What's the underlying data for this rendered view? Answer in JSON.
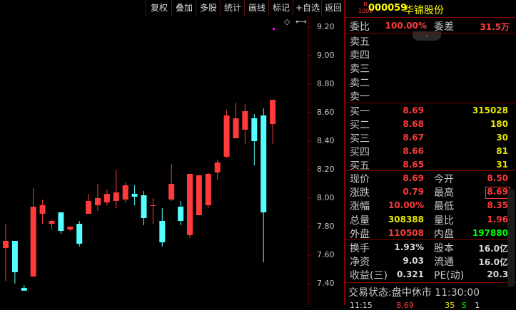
{
  "toolbar": {
    "items": [
      "复权",
      "叠加",
      "多股",
      "统计",
      "画线",
      "标记",
      "+自选",
      "返回"
    ]
  },
  "chart": {
    "y_labels": [
      "9.20",
      "9.00",
      "8.80",
      "8.60",
      "8.40",
      "8.20",
      "8.00",
      "7.80",
      "7.60",
      "7.40"
    ],
    "candles": [
      {
        "o": 7.65,
        "h": 7.82,
        "l": 7.42,
        "c": 7.7
      },
      {
        "o": 7.7,
        "h": 7.7,
        "l": 7.4,
        "c": 7.48
      },
      {
        "o": 7.37,
        "h": 7.39,
        "l": 7.35,
        "c": 7.35
      },
      {
        "o": 7.45,
        "h": 8.07,
        "l": 7.45,
        "c": 7.94
      },
      {
        "o": 7.89,
        "h": 7.99,
        "l": 7.82,
        "c": 7.95
      },
      {
        "o": 7.82,
        "h": 7.85,
        "l": 7.78,
        "c": 7.84
      },
      {
        "o": 7.9,
        "h": 7.9,
        "l": 7.75,
        "c": 7.77
      },
      {
        "o": 7.78,
        "h": 7.8,
        "l": 7.77,
        "c": 7.8
      },
      {
        "o": 7.82,
        "h": 7.84,
        "l": 7.66,
        "c": 7.68
      },
      {
        "o": 7.89,
        "h": 8.03,
        "l": 7.89,
        "c": 7.98
      },
      {
        "o": 7.95,
        "h": 8.1,
        "l": 7.91,
        "c": 8.0
      },
      {
        "o": 7.97,
        "h": 8.06,
        "l": 7.95,
        "c": 8.03
      },
      {
        "o": 7.98,
        "h": 8.2,
        "l": 7.93,
        "c": 8.04
      },
      {
        "o": 7.99,
        "h": 8.11,
        "l": 7.97,
        "c": 8.09
      },
      {
        "o": 8.03,
        "h": 8.09,
        "l": 7.95,
        "c": 8.01
      },
      {
        "o": 8.02,
        "h": 8.05,
        "l": 7.81,
        "c": 7.86
      },
      {
        "o": 7.95,
        "h": 8.0,
        "l": 7.82,
        "c": 7.95
      },
      {
        "o": 7.84,
        "h": 7.93,
        "l": 7.66,
        "c": 7.69
      },
      {
        "o": 7.99,
        "h": 8.24,
        "l": 7.98,
        "c": 8.1
      },
      {
        "o": 7.94,
        "h": 7.98,
        "l": 7.81,
        "c": 7.84
      },
      {
        "o": 7.74,
        "h": 8.17,
        "l": 7.72,
        "c": 8.17
      },
      {
        "o": 7.88,
        "h": 8.15,
        "l": 7.88,
        "c": 8.16
      },
      {
        "o": 7.95,
        "h": 8.18,
        "l": 7.93,
        "c": 8.17
      },
      {
        "o": 8.18,
        "h": 8.27,
        "l": 8.13,
        "c": 8.25
      },
      {
        "o": 8.29,
        "h": 8.62,
        "l": 8.28,
        "c": 8.58
      },
      {
        "o": 8.42,
        "h": 8.67,
        "l": 8.42,
        "c": 8.56
      },
      {
        "o": 8.48,
        "h": 8.66,
        "l": 8.38,
        "c": 8.61
      },
      {
        "o": 8.56,
        "h": 8.59,
        "l": 8.23,
        "c": 8.4
      },
      {
        "o": 8.58,
        "h": 8.63,
        "l": 7.55,
        "c": 7.9
      },
      {
        "o": 8.52,
        "h": 8.69,
        "l": 8.38,
        "c": 8.69
      }
    ],
    "annotations": {
      "diamond": "◇",
      "arrow": "⟷"
    }
  },
  "panel": {
    "code": "000059",
    "name": "华锦股份",
    "badge_top": "R",
    "badge_bottom": "1000",
    "weibi_label": "委比",
    "weibi_value": "100.00%",
    "weicha_label": "委差",
    "weicha_value": "31.5万",
    "collapse_icon": "⌄",
    "sell": [
      {
        "label": "卖五",
        "price": "",
        "vol": ""
      },
      {
        "label": "卖四",
        "price": "",
        "vol": ""
      },
      {
        "label": "卖三",
        "price": "",
        "vol": ""
      },
      {
        "label": "卖二",
        "price": "",
        "vol": ""
      },
      {
        "label": "卖一",
        "price": "",
        "vol": ""
      }
    ],
    "buy": [
      {
        "label": "买一",
        "price": "8.69",
        "vol": "315028"
      },
      {
        "label": "买二",
        "price": "8.68",
        "vol": "180"
      },
      {
        "label": "买三",
        "price": "8.67",
        "vol": "30"
      },
      {
        "label": "买四",
        "price": "8.66",
        "vol": "81"
      },
      {
        "label": "买五",
        "price": "8.65",
        "vol": "31"
      }
    ],
    "quote": [
      {
        "l1": "现价",
        "v1": "8.69",
        "l2": "今开",
        "v2": "8.50"
      },
      {
        "l1": "涨跌",
        "v1": "0.79",
        "l2": "最高",
        "v2": "8.69"
      },
      {
        "l1": "涨幅",
        "v1": "10.00%",
        "l2": "最低",
        "v2": "8.35"
      },
      {
        "l1": "总量",
        "v1": "308388",
        "l2": "量比",
        "v2": "1.96"
      },
      {
        "l1": "外盘",
        "v1": "110508",
        "l2": "内盘",
        "v2": "197880"
      }
    ],
    "fundamentals": [
      {
        "l1": "换手",
        "v1": "1.93%",
        "l2": "股本",
        "v2": "16.0亿"
      },
      {
        "l1": "净资",
        "v1": "9.03",
        "l2": "流通",
        "v2": "16.0亿"
      },
      {
        "l1": "收益(三)",
        "v1": "0.321",
        "l2": "PE(动)",
        "v2": "20.3"
      }
    ],
    "status_label": "交易状态:",
    "status_value": "盘中休市 11:30:00",
    "tick": {
      "time": "11:15",
      "price": "8.69",
      "vol": "35",
      "dir": "S",
      "n": "1"
    }
  },
  "colors": {
    "up": "#ff3b3b",
    "down": "#54ffff",
    "grid": "#800000"
  }
}
